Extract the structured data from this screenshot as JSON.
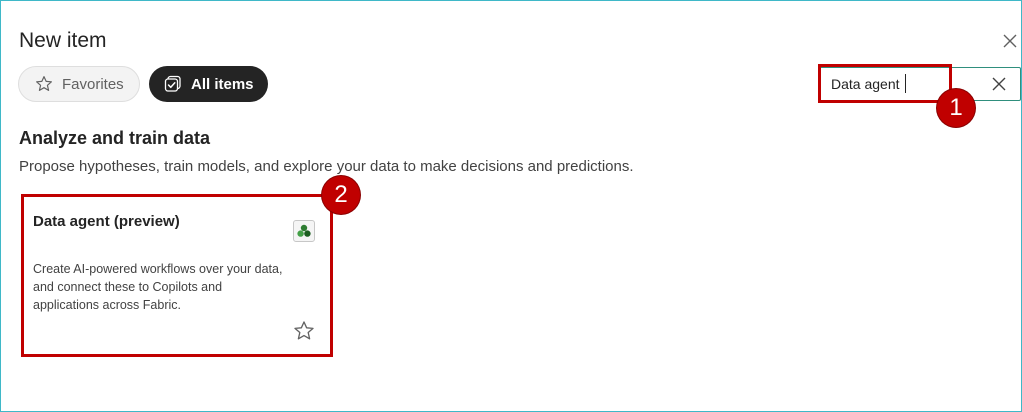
{
  "dialog": {
    "title": "New item"
  },
  "filters": {
    "favorites_label": "Favorites",
    "all_items_label": "All items"
  },
  "search": {
    "value": "Data agent"
  },
  "annotations": {
    "badge_1": "1",
    "badge_2": "2",
    "color": "#c00000"
  },
  "section": {
    "title": "Analyze and train data",
    "description": "Propose hypotheses, train models, and explore your data to make decisions and predictions."
  },
  "card": {
    "title": "Data agent (preview)",
    "description_lines": [
      "Create AI-powered workflows over your data,",
      "and connect these to Copilots and",
      "applications across Fabric."
    ],
    "icon": "data-agent-icon",
    "favorite_icon": "star-outline-icon"
  },
  "icons": {
    "close": "close-icon",
    "star": "star-outline-icon",
    "all_items": "checkbox-stack-icon",
    "clear": "clear-search-icon"
  }
}
